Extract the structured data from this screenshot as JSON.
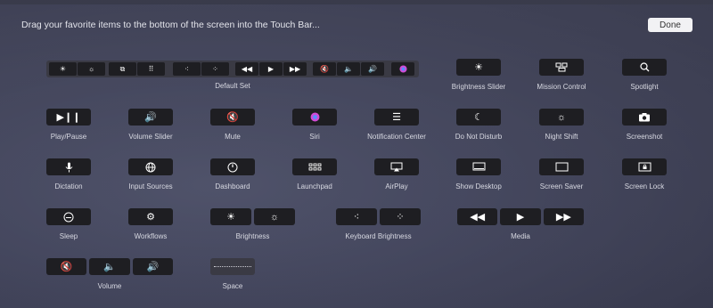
{
  "header": {
    "instruction": "Drag your favorite items to the bottom of the screen into the Touch Bar...",
    "done_label": "Done"
  },
  "default_set": {
    "label": "Default Set"
  },
  "items": {
    "brightness_slider": "Brightness Slider",
    "mission_control": "Mission Control",
    "spotlight": "Spotlight",
    "play_pause": "Play/Pause",
    "volume_slider": "Volume Slider",
    "mute": "Mute",
    "siri": "Siri",
    "notification_center": "Notification Center",
    "do_not_disturb": "Do Not Disturb",
    "night_shift": "Night Shift",
    "screenshot": "Screenshot",
    "dictation": "Dictation",
    "input_sources": "Input Sources",
    "dashboard": "Dashboard",
    "launchpad": "Launchpad",
    "airplay": "AirPlay",
    "show_desktop": "Show Desktop",
    "screen_saver": "Screen Saver",
    "screen_lock": "Screen Lock",
    "sleep": "Sleep",
    "workflows": "Workflows",
    "brightness": "Brightness",
    "keyboard_brightness": "Keyboard Brightness",
    "media": "Media",
    "volume": "Volume",
    "space": "Space"
  },
  "colors": {
    "key_bg": "#1e1e22",
    "group_bg": "#3a3a44",
    "done_bg": "#f2f2f4",
    "siri_accent": "#d14cd6"
  }
}
